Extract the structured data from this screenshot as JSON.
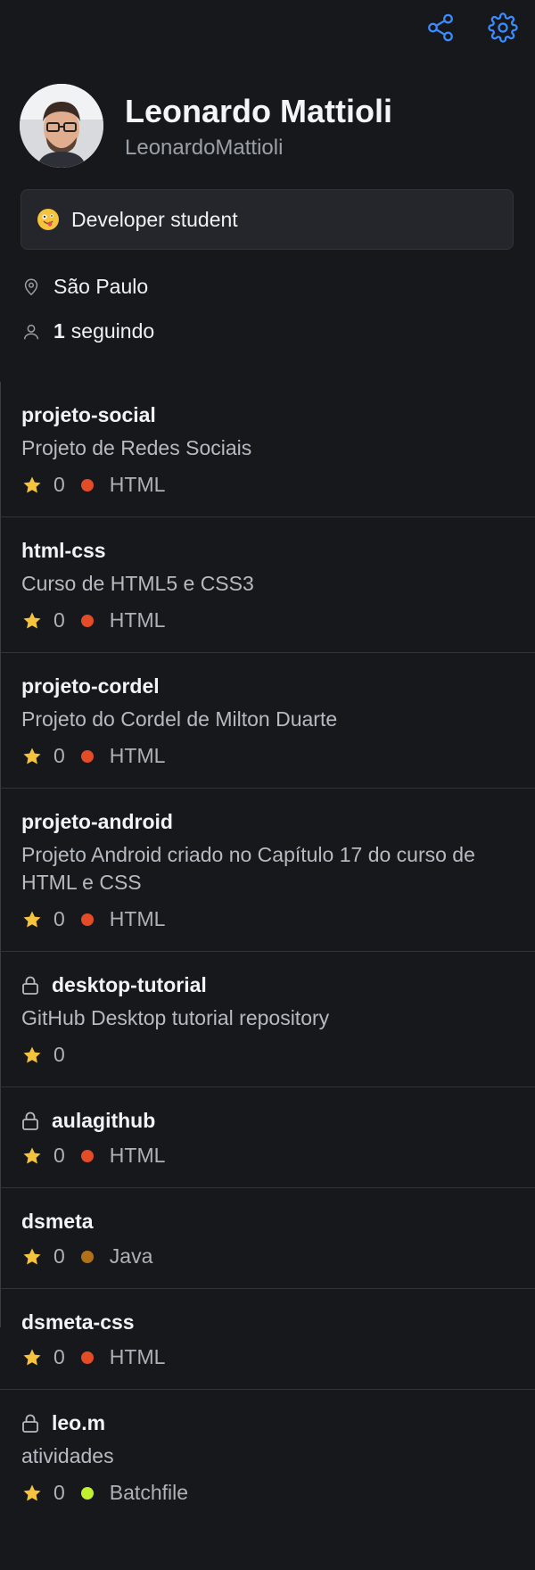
{
  "header": {
    "share_icon": "share-icon",
    "settings_icon": "gear-icon"
  },
  "profile": {
    "name": "Leonardo Mattioli",
    "username": "LeonardoMattioli",
    "status": "Developer student",
    "location": "São Paulo",
    "following_count": "1",
    "following_label": "seguindo"
  },
  "repos": [
    {
      "name": "projeto-social",
      "desc": "Projeto de Redes Sociais",
      "stars": "0",
      "lang": "HTML",
      "lang_color": "#e34c26",
      "private": false
    },
    {
      "name": "html-css",
      "desc": "Curso de HTML5 e CSS3",
      "stars": "0",
      "lang": "HTML",
      "lang_color": "#e34c26",
      "private": false
    },
    {
      "name": "projeto-cordel",
      "desc": "Projeto do Cordel de Milton Duarte",
      "stars": "0",
      "lang": "HTML",
      "lang_color": "#e34c26",
      "private": false
    },
    {
      "name": "projeto-android",
      "desc": "Projeto Android criado no Capítulo 17 do curso de HTML e CSS",
      "stars": "0",
      "lang": "HTML",
      "lang_color": "#e34c26",
      "private": false
    },
    {
      "name": "desktop-tutorial",
      "desc": "GitHub Desktop tutorial repository",
      "stars": "0",
      "lang": "",
      "lang_color": "",
      "private": true
    },
    {
      "name": "aulagithub",
      "desc": "",
      "stars": "0",
      "lang": "HTML",
      "lang_color": "#e34c26",
      "private": true
    },
    {
      "name": "dsmeta",
      "desc": "",
      "stars": "0",
      "lang": "Java",
      "lang_color": "#b07219",
      "private": false
    },
    {
      "name": "dsmeta-css",
      "desc": "",
      "stars": "0",
      "lang": "HTML",
      "lang_color": "#e34c26",
      "private": false
    },
    {
      "name": "leo.m",
      "desc": "atividades",
      "stars": "0",
      "lang": "Batchfile",
      "lang_color": "#c1f12e",
      "private": true
    }
  ],
  "colors": {
    "accent": "#3b8cff",
    "star": "#f6c33d",
    "background": "#17181c"
  }
}
